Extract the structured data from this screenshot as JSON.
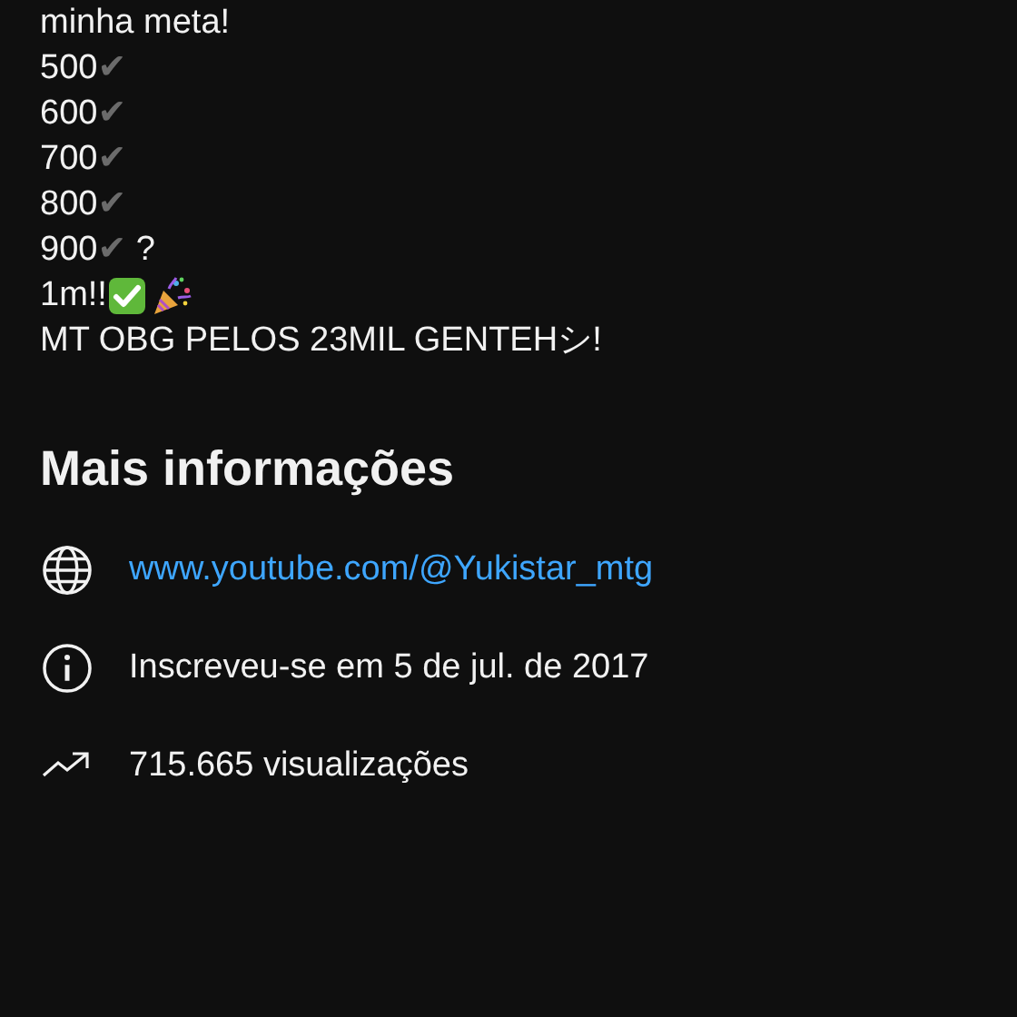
{
  "description": [
    {
      "kind": "text",
      "text": "minha meta!"
    },
    {
      "kind": "milestone",
      "text": "500",
      "check": "✔"
    },
    {
      "kind": "milestone",
      "text": "600",
      "check": "✔"
    },
    {
      "kind": "milestone",
      "text": "700",
      "check": "✔"
    },
    {
      "kind": "milestone",
      "text": "800",
      "check": "✔"
    },
    {
      "kind": "milestone",
      "text": "900",
      "check": "✔",
      "after": " ?"
    },
    {
      "kind": "celebration",
      "text": "1m!!"
    },
    {
      "kind": "text",
      "text": "MT OBG PELOS 23MIL GENTEHシ!"
    }
  ],
  "more_info": {
    "title": "Mais informações",
    "rows": [
      {
        "kind": "link",
        "text": "www.youtube.com/@Yukistar_mtg"
      },
      {
        "kind": "joined",
        "text": "Inscreveu-se em 5 de jul. de 2017"
      },
      {
        "kind": "views",
        "text": "715.665 visualizações"
      }
    ]
  }
}
